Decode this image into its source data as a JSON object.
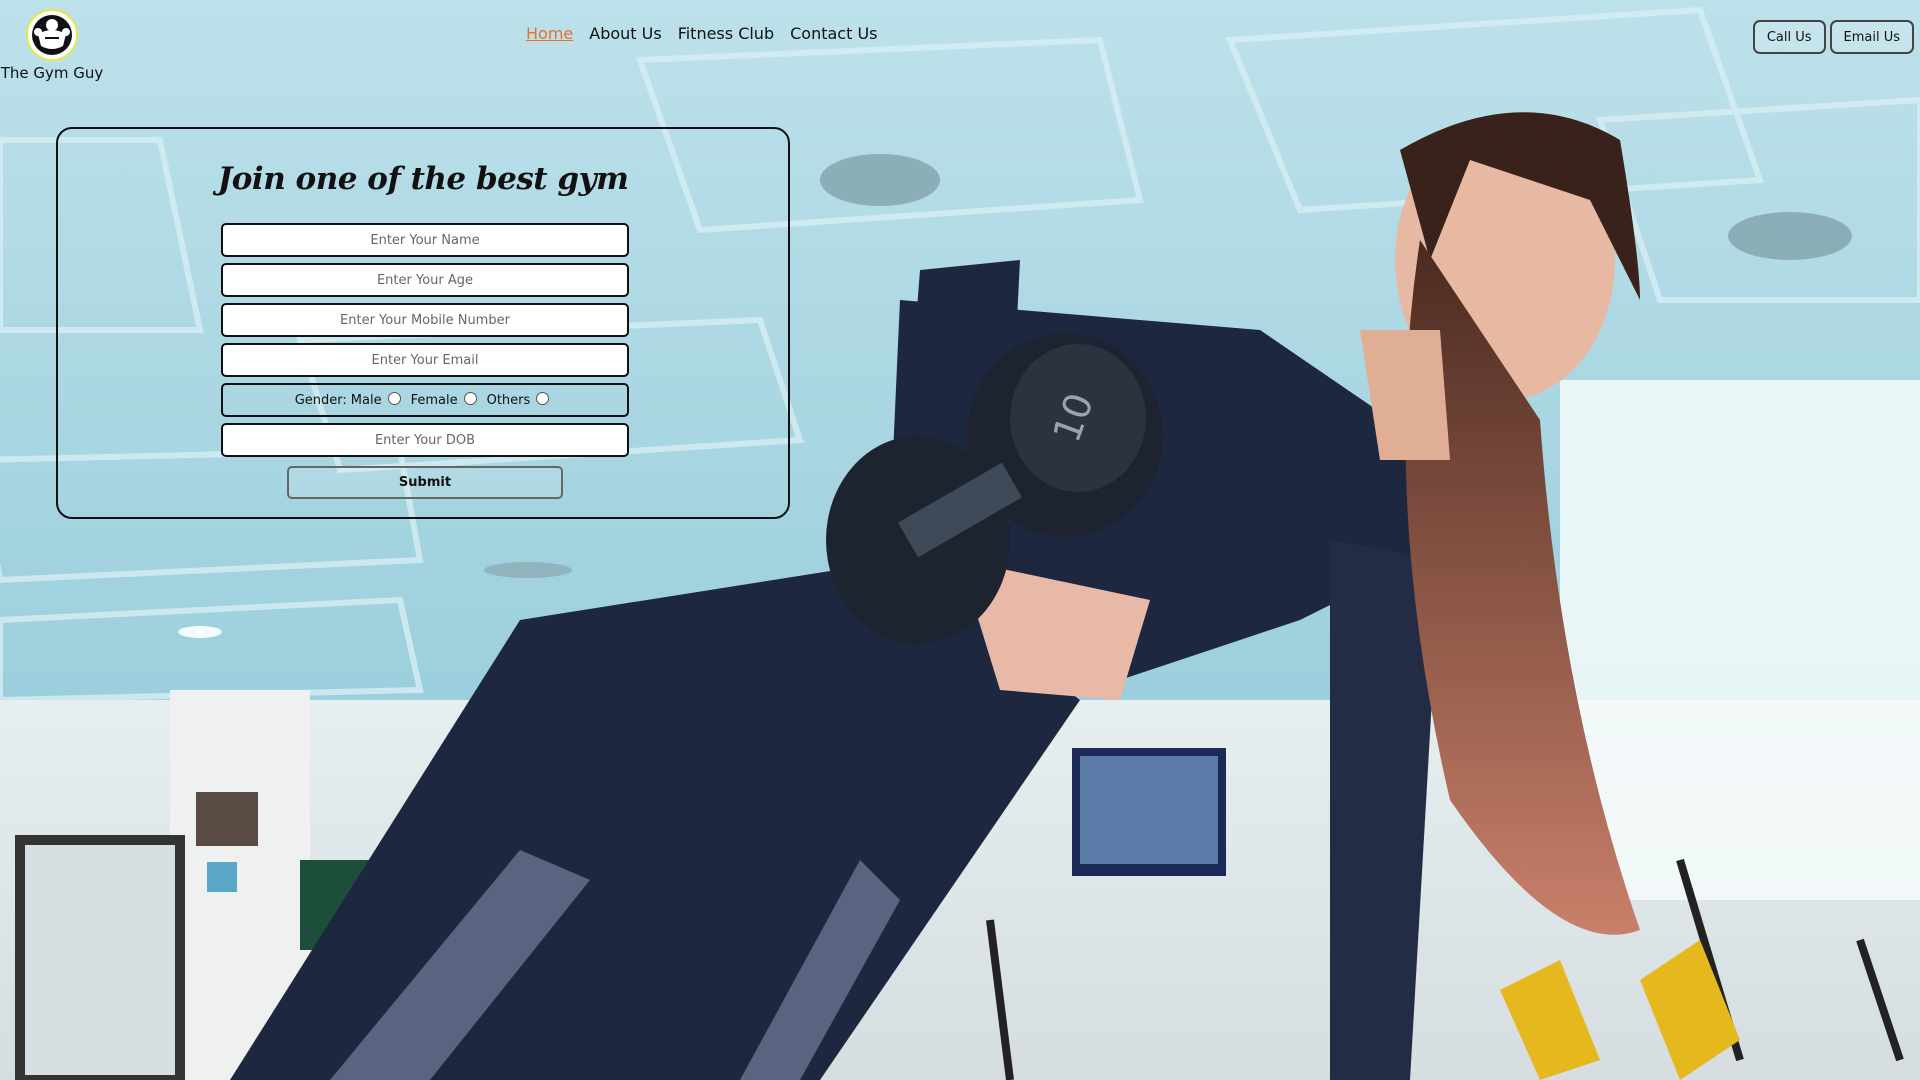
{
  "brand": {
    "name": "The Gym Guy",
    "logo_icon": "bodybuilder-icon"
  },
  "nav": {
    "items": [
      {
        "label": "Home",
        "active": true
      },
      {
        "label": "About Us",
        "active": false
      },
      {
        "label": "Fitness Club",
        "active": false
      },
      {
        "label": "Contact Us",
        "active": false
      }
    ],
    "active_color": "#e8702a"
  },
  "actions": {
    "call_label": "Call Us",
    "email_label": "Email Us"
  },
  "form": {
    "title": "Join one of the best gym",
    "name_placeholder": "Enter Your Name",
    "age_placeholder": "Enter Your Age",
    "mobile_placeholder": "Enter Your Mobile Number",
    "email_placeholder": "Enter Your Email",
    "gender": {
      "label": "Gender:",
      "options": [
        "Male",
        "Female",
        "Others"
      ]
    },
    "dob_placeholder": "Enter Your DOB",
    "submit_label": "Submit"
  },
  "background": {
    "description_icon": "gym-workout-photo"
  }
}
